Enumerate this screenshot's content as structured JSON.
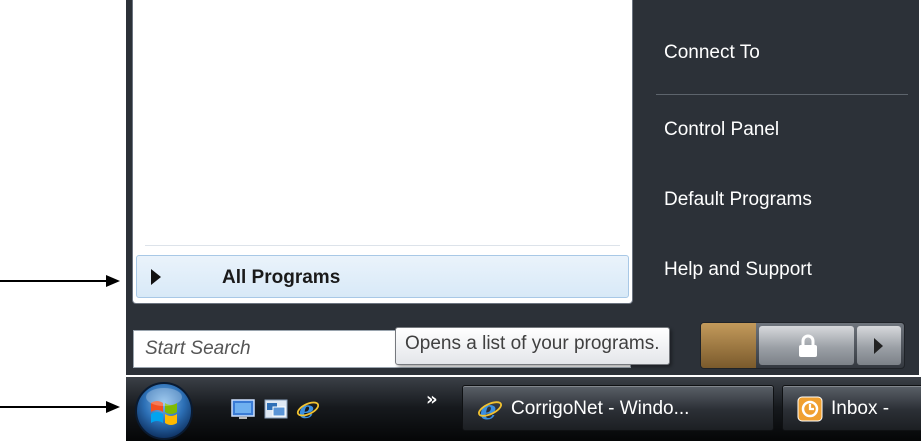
{
  "start_menu": {
    "all_programs_label": "All Programs",
    "right_items": [
      "Connect To",
      "Control Panel",
      "Default Programs",
      "Help and Support"
    ],
    "search_placeholder": "Start Search"
  },
  "tooltip": {
    "text": "Opens a list of your programs."
  },
  "taskbar": {
    "overflow_chevron": "»",
    "tasks": [
      {
        "label": "CorrigoNet - Windo...",
        "icon": "internet-explorer-icon"
      },
      {
        "label": "Inbox - ",
        "icon": "outlook-inbox-icon"
      }
    ]
  },
  "colors": {
    "menu_dark": "#2c3138",
    "highlight": "#d8e9f7",
    "taskbar": "#16191d",
    "orb_blue": "#2c6fb5"
  }
}
